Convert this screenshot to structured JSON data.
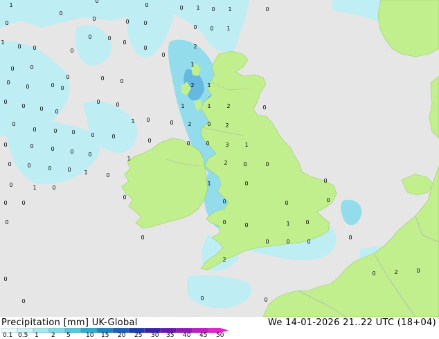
{
  "legend": {
    "title": "Precipitation [mm]",
    "model": "UK-Global",
    "time": "We 14-01-2026 21..22 UTC (18+04)",
    "scale_labels": [
      "0.1",
      "0.5",
      "1",
      "2",
      "5",
      "10",
      "15",
      "20",
      "25",
      "30",
      "35",
      "40",
      "45",
      "50"
    ],
    "scale_colors": [
      "#e6f9fb",
      "#c9f2f6",
      "#a7e8f0",
      "#84dbe8",
      "#56c8dc",
      "#2faad2",
      "#1b86c6",
      "#1a5fbc",
      "#1e3cb0",
      "#3a1fae",
      "#6a16b6",
      "#9914be",
      "#c51ac6",
      "#e61fd0"
    ]
  },
  "colors": {
    "sea": "#e6e6e6",
    "land": "#c2ef8e",
    "border": "#b8b8b8",
    "rain_light": "#bdeef5",
    "rain_medium": "#8fdcec",
    "rain_heavy": "#5fb7e0"
  },
  "markers": [
    {
      "t": "1"
    },
    {
      "t": "0"
    },
    {
      "t": "0"
    },
    {
      "t": "0"
    },
    {
      "t": "0"
    },
    {
      "t": "1"
    },
    {
      "t": "0"
    },
    {
      "t": "1"
    },
    {
      "t": "0"
    },
    {
      "t": "0"
    },
    {
      "t": "0"
    },
    {
      "t": "0"
    },
    {
      "t": "0"
    },
    {
      "t": "0"
    },
    {
      "t": "0"
    },
    {
      "t": "1"
    },
    {
      "t": "0"
    },
    {
      "t": "0"
    },
    {
      "t": "1"
    },
    {
      "t": "0"
    },
    {
      "t": "0"
    },
    {
      "t": "0"
    },
    {
      "t": "0"
    },
    {
      "t": "2"
    },
    {
      "t": "1"
    },
    {
      "t": "0"
    },
    {
      "t": "0"
    },
    {
      "t": "0"
    },
    {
      "t": "0"
    },
    {
      "t": "0"
    },
    {
      "t": "0"
    },
    {
      "t": "2"
    },
    {
      "t": "1"
    },
    {
      "t": "0"
    },
    {
      "t": "0"
    },
    {
      "t": "0"
    },
    {
      "t": "0"
    },
    {
      "t": "0"
    },
    {
      "t": "1"
    },
    {
      "t": "1"
    },
    {
      "t": "2"
    },
    {
      "t": "0"
    },
    {
      "t": "0"
    },
    {
      "t": "0"
    },
    {
      "t": "0"
    },
    {
      "t": "0"
    },
    {
      "t": "0"
    },
    {
      "t": "1"
    },
    {
      "t": "0"
    },
    {
      "t": "0"
    },
    {
      "t": "2"
    },
    {
      "t": "0"
    },
    {
      "t": "2"
    },
    {
      "t": "0"
    },
    {
      "t": "0"
    },
    {
      "t": "0"
    },
    {
      "t": "0"
    },
    {
      "t": "0"
    },
    {
      "t": "0"
    },
    {
      "t": "0"
    },
    {
      "t": "0"
    },
    {
      "t": "0"
    },
    {
      "t": "0"
    },
    {
      "t": "0"
    },
    {
      "t": "3"
    },
    {
      "t": "1"
    },
    {
      "t": "0"
    },
    {
      "t": "0"
    },
    {
      "t": "0"
    },
    {
      "t": "0"
    },
    {
      "t": "1"
    },
    {
      "t": "2"
    },
    {
      "t": "0"
    },
    {
      "t": "0"
    },
    {
      "t": "0"
    },
    {
      "t": "0"
    },
    {
      "t": "0"
    },
    {
      "t": "0"
    },
    {
      "t": "1"
    },
    {
      "t": "0"
    },
    {
      "t": "0"
    },
    {
      "t": "0"
    },
    {
      "t": "1"
    },
    {
      "t": "0"
    },
    {
      "t": "0"
    },
    {
      "t": "0"
    },
    {
      "t": "1"
    },
    {
      "t": "0"
    },
    {
      "t": "0"
    },
    {
      "t": "0"
    },
    {
      "t": "0"
    },
    {
      "t": "0"
    },
    {
      "t": "0"
    },
    {
      "t": "0"
    },
    {
      "t": "0"
    },
    {
      "t": "0"
    },
    {
      "t": "1"
    },
    {
      "t": "0"
    },
    {
      "t": "0"
    },
    {
      "t": "0"
    },
    {
      "t": "0"
    },
    {
      "t": "0"
    },
    {
      "t": "2"
    },
    {
      "t": "2"
    },
    {
      "t": "0"
    },
    {
      "t": "0"
    },
    {
      "t": "0"
    },
    {
      "t": "0"
    },
    {
      "t": "0"
    },
    {
      "t": "0"
    },
    {
      "t": "0"
    },
    {
      "t": "0"
    }
  ]
}
